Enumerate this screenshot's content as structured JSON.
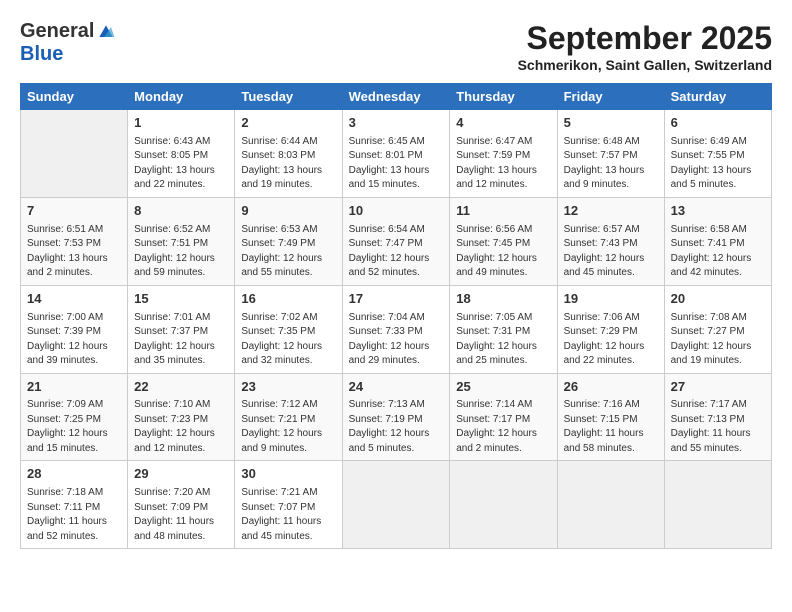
{
  "logo": {
    "general": "General",
    "blue": "Blue"
  },
  "title": {
    "month_year": "September 2025",
    "location": "Schmerikon, Saint Gallen, Switzerland"
  },
  "days_of_week": [
    "Sunday",
    "Monday",
    "Tuesday",
    "Wednesday",
    "Thursday",
    "Friday",
    "Saturday"
  ],
  "weeks": [
    [
      {
        "day": "",
        "sunrise": "",
        "sunset": "",
        "daylight": "",
        "empty": true
      },
      {
        "day": "1",
        "sunrise": "Sunrise: 6:43 AM",
        "sunset": "Sunset: 8:05 PM",
        "daylight": "Daylight: 13 hours and 22 minutes."
      },
      {
        "day": "2",
        "sunrise": "Sunrise: 6:44 AM",
        "sunset": "Sunset: 8:03 PM",
        "daylight": "Daylight: 13 hours and 19 minutes."
      },
      {
        "day": "3",
        "sunrise": "Sunrise: 6:45 AM",
        "sunset": "Sunset: 8:01 PM",
        "daylight": "Daylight: 13 hours and 15 minutes."
      },
      {
        "day": "4",
        "sunrise": "Sunrise: 6:47 AM",
        "sunset": "Sunset: 7:59 PM",
        "daylight": "Daylight: 13 hours and 12 minutes."
      },
      {
        "day": "5",
        "sunrise": "Sunrise: 6:48 AM",
        "sunset": "Sunset: 7:57 PM",
        "daylight": "Daylight: 13 hours and 9 minutes."
      },
      {
        "day": "6",
        "sunrise": "Sunrise: 6:49 AM",
        "sunset": "Sunset: 7:55 PM",
        "daylight": "Daylight: 13 hours and 5 minutes."
      }
    ],
    [
      {
        "day": "7",
        "sunrise": "Sunrise: 6:51 AM",
        "sunset": "Sunset: 7:53 PM",
        "daylight": "Daylight: 13 hours and 2 minutes."
      },
      {
        "day": "8",
        "sunrise": "Sunrise: 6:52 AM",
        "sunset": "Sunset: 7:51 PM",
        "daylight": "Daylight: 12 hours and 59 minutes."
      },
      {
        "day": "9",
        "sunrise": "Sunrise: 6:53 AM",
        "sunset": "Sunset: 7:49 PM",
        "daylight": "Daylight: 12 hours and 55 minutes."
      },
      {
        "day": "10",
        "sunrise": "Sunrise: 6:54 AM",
        "sunset": "Sunset: 7:47 PM",
        "daylight": "Daylight: 12 hours and 52 minutes."
      },
      {
        "day": "11",
        "sunrise": "Sunrise: 6:56 AM",
        "sunset": "Sunset: 7:45 PM",
        "daylight": "Daylight: 12 hours and 49 minutes."
      },
      {
        "day": "12",
        "sunrise": "Sunrise: 6:57 AM",
        "sunset": "Sunset: 7:43 PM",
        "daylight": "Daylight: 12 hours and 45 minutes."
      },
      {
        "day": "13",
        "sunrise": "Sunrise: 6:58 AM",
        "sunset": "Sunset: 7:41 PM",
        "daylight": "Daylight: 12 hours and 42 minutes."
      }
    ],
    [
      {
        "day": "14",
        "sunrise": "Sunrise: 7:00 AM",
        "sunset": "Sunset: 7:39 PM",
        "daylight": "Daylight: 12 hours and 39 minutes."
      },
      {
        "day": "15",
        "sunrise": "Sunrise: 7:01 AM",
        "sunset": "Sunset: 7:37 PM",
        "daylight": "Daylight: 12 hours and 35 minutes."
      },
      {
        "day": "16",
        "sunrise": "Sunrise: 7:02 AM",
        "sunset": "Sunset: 7:35 PM",
        "daylight": "Daylight: 12 hours and 32 minutes."
      },
      {
        "day": "17",
        "sunrise": "Sunrise: 7:04 AM",
        "sunset": "Sunset: 7:33 PM",
        "daylight": "Daylight: 12 hours and 29 minutes."
      },
      {
        "day": "18",
        "sunrise": "Sunrise: 7:05 AM",
        "sunset": "Sunset: 7:31 PM",
        "daylight": "Daylight: 12 hours and 25 minutes."
      },
      {
        "day": "19",
        "sunrise": "Sunrise: 7:06 AM",
        "sunset": "Sunset: 7:29 PM",
        "daylight": "Daylight: 12 hours and 22 minutes."
      },
      {
        "day": "20",
        "sunrise": "Sunrise: 7:08 AM",
        "sunset": "Sunset: 7:27 PM",
        "daylight": "Daylight: 12 hours and 19 minutes."
      }
    ],
    [
      {
        "day": "21",
        "sunrise": "Sunrise: 7:09 AM",
        "sunset": "Sunset: 7:25 PM",
        "daylight": "Daylight: 12 hours and 15 minutes."
      },
      {
        "day": "22",
        "sunrise": "Sunrise: 7:10 AM",
        "sunset": "Sunset: 7:23 PM",
        "daylight": "Daylight: 12 hours and 12 minutes."
      },
      {
        "day": "23",
        "sunrise": "Sunrise: 7:12 AM",
        "sunset": "Sunset: 7:21 PM",
        "daylight": "Daylight: 12 hours and 9 minutes."
      },
      {
        "day": "24",
        "sunrise": "Sunrise: 7:13 AM",
        "sunset": "Sunset: 7:19 PM",
        "daylight": "Daylight: 12 hours and 5 minutes."
      },
      {
        "day": "25",
        "sunrise": "Sunrise: 7:14 AM",
        "sunset": "Sunset: 7:17 PM",
        "daylight": "Daylight: 12 hours and 2 minutes."
      },
      {
        "day": "26",
        "sunrise": "Sunrise: 7:16 AM",
        "sunset": "Sunset: 7:15 PM",
        "daylight": "Daylight: 11 hours and 58 minutes."
      },
      {
        "day": "27",
        "sunrise": "Sunrise: 7:17 AM",
        "sunset": "Sunset: 7:13 PM",
        "daylight": "Daylight: 11 hours and 55 minutes."
      }
    ],
    [
      {
        "day": "28",
        "sunrise": "Sunrise: 7:18 AM",
        "sunset": "Sunset: 7:11 PM",
        "daylight": "Daylight: 11 hours and 52 minutes."
      },
      {
        "day": "29",
        "sunrise": "Sunrise: 7:20 AM",
        "sunset": "Sunset: 7:09 PM",
        "daylight": "Daylight: 11 hours and 48 minutes."
      },
      {
        "day": "30",
        "sunrise": "Sunrise: 7:21 AM",
        "sunset": "Sunset: 7:07 PM",
        "daylight": "Daylight: 11 hours and 45 minutes."
      },
      {
        "day": "",
        "sunrise": "",
        "sunset": "",
        "daylight": "",
        "empty": true
      },
      {
        "day": "",
        "sunrise": "",
        "sunset": "",
        "daylight": "",
        "empty": true
      },
      {
        "day": "",
        "sunrise": "",
        "sunset": "",
        "daylight": "",
        "empty": true
      },
      {
        "day": "",
        "sunrise": "",
        "sunset": "",
        "daylight": "",
        "empty": true
      }
    ]
  ]
}
